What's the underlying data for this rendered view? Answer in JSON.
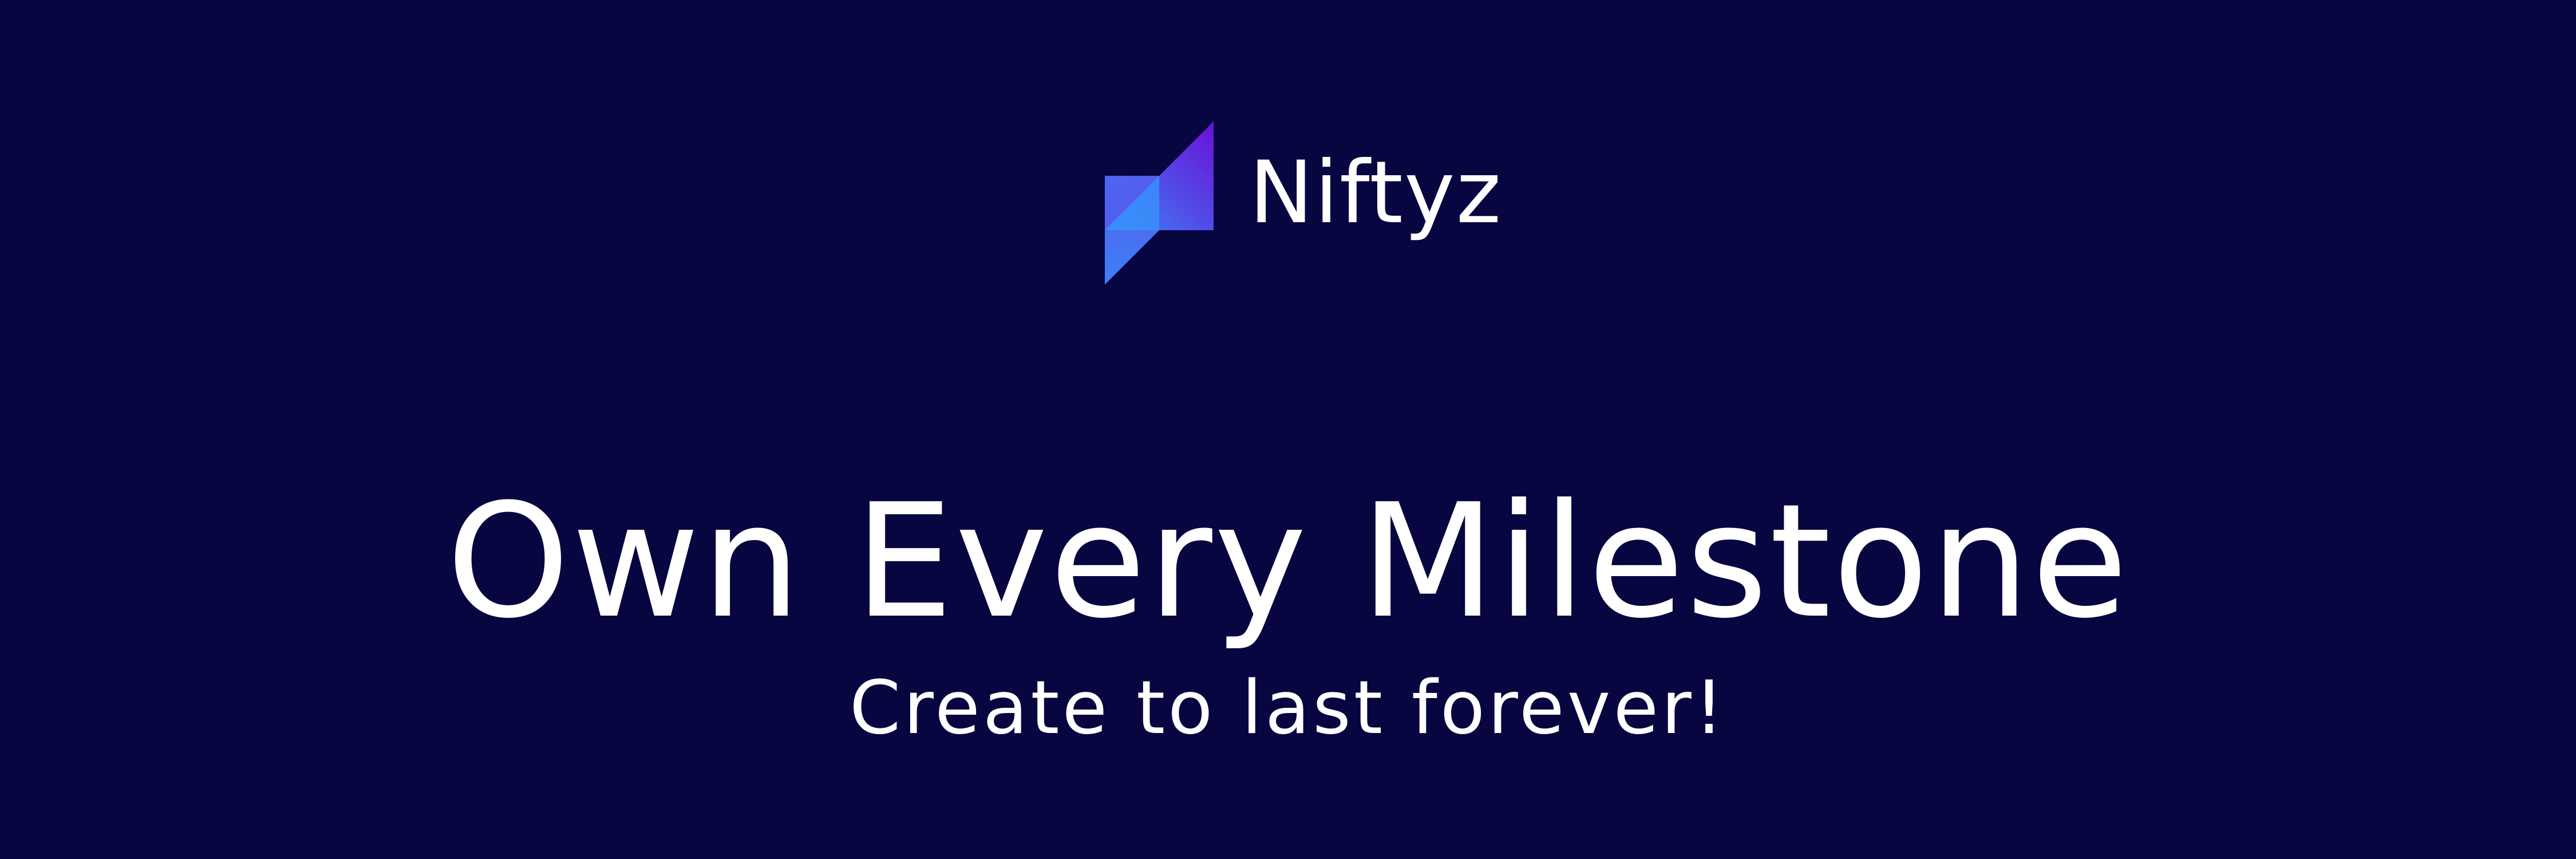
{
  "brand": {
    "name": "Niftyz",
    "logo_icon": "niftyz-logo-icon",
    "logo_colors": [
      "#4a63f0",
      "#3a8bf8",
      "#6a12d8"
    ]
  },
  "hero": {
    "headline": "Own Every Milestone",
    "tagline": "Create to last forever!"
  },
  "colors": {
    "background": "#080640",
    "text": "#ffffff"
  }
}
